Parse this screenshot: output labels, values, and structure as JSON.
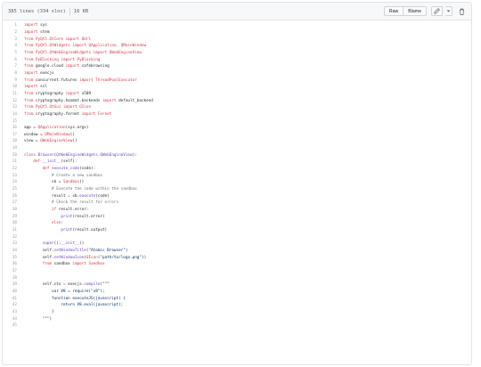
{
  "file_header": {
    "lines_info": "385 lines (334 sloc)",
    "size": "16 KB",
    "raw_label": "Raw",
    "blame_label": "Blame"
  },
  "icons": {
    "edit": "pencil-icon",
    "menu": "chevron-down-icon",
    "delete": "trash-icon"
  },
  "colors": {
    "keyword": "#d73a49",
    "class_name": "#6f42c1",
    "string": "#032f62",
    "comment": "#6a737d",
    "line_number": "#959da5"
  },
  "code_lines": [
    {
      "n": "1",
      "tokens": [
        {
          "t": "import",
          "c": "kw"
        },
        {
          "t": " sys",
          "c": ""
        }
      ]
    },
    {
      "n": "2",
      "tokens": [
        {
          "t": "import",
          "c": "kw"
        },
        {
          "t": " stem",
          "c": ""
        }
      ]
    },
    {
      "n": "3",
      "tokens": [
        {
          "t": "from",
          "c": "kw"
        },
        {
          "t": " ",
          "c": ""
        },
        {
          "t": "PyQt5.QtCore",
          "c": "kw"
        },
        {
          "t": " ",
          "c": ""
        },
        {
          "t": "import",
          "c": "kw"
        },
        {
          "t": " ",
          "c": ""
        },
        {
          "t": "QUrl",
          "c": "kw"
        }
      ]
    },
    {
      "n": "4",
      "tokens": [
        {
          "t": "from",
          "c": "kw"
        },
        {
          "t": " ",
          "c": ""
        },
        {
          "t": "PyQt5.QtWidgets",
          "c": "kw"
        },
        {
          "t": " ",
          "c": ""
        },
        {
          "t": "import",
          "c": "kw"
        },
        {
          "t": " ",
          "c": ""
        },
        {
          "t": "QApplication, QMainWindow",
          "c": "kw"
        }
      ]
    },
    {
      "n": "5",
      "tokens": [
        {
          "t": "from",
          "c": "kw"
        },
        {
          "t": " ",
          "c": ""
        },
        {
          "t": "PyQt5.QtWebEngineWidgets",
          "c": "kw"
        },
        {
          "t": " ",
          "c": ""
        },
        {
          "t": "import",
          "c": "kw"
        },
        {
          "t": " ",
          "c": ""
        },
        {
          "t": "QWebEngineView",
          "c": "kw"
        }
      ]
    },
    {
      "n": "6",
      "tokens": [
        {
          "t": "from",
          "c": "kw"
        },
        {
          "t": " ",
          "c": ""
        },
        {
          "t": "PyBlocking",
          "c": "kw"
        },
        {
          "t": " ",
          "c": ""
        },
        {
          "t": "import",
          "c": "kw"
        },
        {
          "t": " ",
          "c": ""
        },
        {
          "t": "PyBlocking",
          "c": "kw"
        }
      ]
    },
    {
      "n": "7",
      "tokens": [
        {
          "t": "from",
          "c": "kw"
        },
        {
          "t": " google.cloud ",
          "c": ""
        },
        {
          "t": "import",
          "c": "kw"
        },
        {
          "t": " safebrowsing",
          "c": ""
        }
      ]
    },
    {
      "n": "8",
      "tokens": [
        {
          "t": "import",
          "c": "kw"
        },
        {
          "t": " execjs",
          "c": ""
        }
      ]
    },
    {
      "n": "9",
      "tokens": [
        {
          "t": "from",
          "c": "kw"
        },
        {
          "t": " concurrent.futures ",
          "c": ""
        },
        {
          "t": "import",
          "c": "kw"
        },
        {
          "t": " ",
          "c": ""
        },
        {
          "t": "ThreadPoolExecutor",
          "c": "kw"
        }
      ]
    },
    {
      "n": "10",
      "tokens": [
        {
          "t": "import",
          "c": "kw"
        },
        {
          "t": " ssl",
          "c": ""
        }
      ]
    },
    {
      "n": "11",
      "tokens": [
        {
          "t": "from",
          "c": "kw"
        },
        {
          "t": " cryptography ",
          "c": ""
        },
        {
          "t": "import",
          "c": "kw"
        },
        {
          "t": " x509",
          "c": ""
        }
      ]
    },
    {
      "n": "12",
      "tokens": [
        {
          "t": "from",
          "c": "kw"
        },
        {
          "t": " cryptography.hazmat.backends ",
          "c": ""
        },
        {
          "t": "import",
          "c": "kw"
        },
        {
          "t": " default_backend",
          "c": ""
        }
      ]
    },
    {
      "n": "13",
      "tokens": [
        {
          "t": "from",
          "c": "kw"
        },
        {
          "t": " ",
          "c": ""
        },
        {
          "t": "PyQt5.QtGui",
          "c": "kw"
        },
        {
          "t": " ",
          "c": ""
        },
        {
          "t": "import",
          "c": "kw"
        },
        {
          "t": " ",
          "c": ""
        },
        {
          "t": "QIcon",
          "c": "kw"
        }
      ]
    },
    {
      "n": "14",
      "tokens": [
        {
          "t": "from",
          "c": "kw"
        },
        {
          "t": " cryptography.fernet ",
          "c": ""
        },
        {
          "t": "import",
          "c": "kw"
        },
        {
          "t": " ",
          "c": ""
        },
        {
          "t": "Fernet",
          "c": "kw"
        }
      ]
    },
    {
      "n": "15",
      "tokens": []
    },
    {
      "n": "16",
      "tokens": [
        {
          "t": "app = ",
          "c": ""
        },
        {
          "t": "QApplication",
          "c": "kw"
        },
        {
          "t": "(sys.argv)",
          "c": ""
        }
      ]
    },
    {
      "n": "17",
      "tokens": [
        {
          "t": "window = ",
          "c": ""
        },
        {
          "t": "QMainWindow",
          "c": "kw"
        },
        {
          "t": "()",
          "c": ""
        }
      ]
    },
    {
      "n": "18",
      "tokens": [
        {
          "t": "view = ",
          "c": ""
        },
        {
          "t": "QWebEngineView",
          "c": "kw"
        },
        {
          "t": "()",
          "c": ""
        }
      ]
    },
    {
      "n": "19",
      "tokens": []
    },
    {
      "n": "20",
      "tokens": [
        {
          "t": "class",
          "c": "kw"
        },
        {
          "t": " ",
          "c": ""
        },
        {
          "t": "Browser",
          "c": "cls"
        },
        {
          "t": "(",
          "c": ""
        },
        {
          "t": "QtWebEngineWidgets.QWebEngineView",
          "c": "cls"
        },
        {
          "t": "):",
          "c": ""
        }
      ]
    },
    {
      "n": "21",
      "tokens": [
        {
          "t": "    ",
          "c": ""
        },
        {
          "t": "def",
          "c": "kw"
        },
        {
          "t": " ",
          "c": ""
        },
        {
          "t": "__init__",
          "c": "fn"
        },
        {
          "t": "(self):",
          "c": ""
        }
      ]
    },
    {
      "n": "22",
      "tokens": [
        {
          "t": "        ",
          "c": ""
        },
        {
          "t": "def",
          "c": "kw"
        },
        {
          "t": " ",
          "c": ""
        },
        {
          "t": "execute_code",
          "c": "fn"
        },
        {
          "t": "(code):",
          "c": ""
        }
      ]
    },
    {
      "n": "23",
      "tokens": [
        {
          "t": "            ",
          "c": ""
        },
        {
          "t": "# Create a new sandbox",
          "c": "cm"
        }
      ]
    },
    {
      "n": "24",
      "tokens": [
        {
          "t": "            sb = ",
          "c": ""
        },
        {
          "t": "Sandbox",
          "c": "kw"
        },
        {
          "t": "()",
          "c": ""
        }
      ]
    },
    {
      "n": "25",
      "tokens": [
        {
          "t": "            ",
          "c": ""
        },
        {
          "t": "# Execute the code within the sandbox",
          "c": "cm"
        }
      ]
    },
    {
      "n": "26",
      "tokens": [
        {
          "t": "            result ",
          "c": ""
        },
        {
          "t": "=",
          "c": "kw"
        },
        {
          "t": " sb.",
          "c": ""
        },
        {
          "t": "execute",
          "c": "fn"
        },
        {
          "t": "(code)",
          "c": ""
        }
      ]
    },
    {
      "n": "27",
      "tokens": [
        {
          "t": "            ",
          "c": ""
        },
        {
          "t": "# Check the result for errors",
          "c": "cm"
        }
      ]
    },
    {
      "n": "28",
      "tokens": [
        {
          "t": "            ",
          "c": ""
        },
        {
          "t": "if",
          "c": "kw"
        },
        {
          "t": " result.error:",
          "c": ""
        }
      ]
    },
    {
      "n": "29",
      "tokens": [
        {
          "t": "                ",
          "c": ""
        },
        {
          "t": "print",
          "c": "fn"
        },
        {
          "t": "(result.error)",
          "c": ""
        }
      ]
    },
    {
      "n": "30",
      "tokens": [
        {
          "t": "            ",
          "c": ""
        },
        {
          "t": "else",
          "c": "kw"
        },
        {
          "t": ":",
          "c": ""
        }
      ]
    },
    {
      "n": "31",
      "tokens": [
        {
          "t": "                ",
          "c": ""
        },
        {
          "t": "print",
          "c": "fn"
        },
        {
          "t": "(result.output)",
          "c": ""
        }
      ]
    },
    {
      "n": "32",
      "tokens": []
    },
    {
      "n": "33",
      "tokens": [
        {
          "t": "        ",
          "c": ""
        },
        {
          "t": "super",
          "c": "fn"
        },
        {
          "t": "().",
          "c": ""
        },
        {
          "t": "__init__",
          "c": "fn"
        },
        {
          "t": "()",
          "c": ""
        }
      ]
    },
    {
      "n": "34",
      "tokens": [
        {
          "t": "        self.",
          "c": ""
        },
        {
          "t": "setWindowTitle",
          "c": "fn"
        },
        {
          "t": "(",
          "c": ""
        },
        {
          "t": "\"Atomic Browser\"",
          "c": "str"
        },
        {
          "t": ")",
          "c": ""
        }
      ]
    },
    {
      "n": "35",
      "tokens": [
        {
          "t": "        self.",
          "c": ""
        },
        {
          "t": "setWindowIcon",
          "c": "fn"
        },
        {
          "t": "(",
          "c": ""
        },
        {
          "t": "QIcon",
          "c": "kw"
        },
        {
          "t": "(",
          "c": ""
        },
        {
          "t": "\"path/to/logo.png\"",
          "c": "str"
        },
        {
          "t": "))",
          "c": ""
        }
      ]
    },
    {
      "n": "36",
      "tokens": [
        {
          "t": "        ",
          "c": ""
        },
        {
          "t": "from",
          "c": "kw"
        },
        {
          "t": " sandbox ",
          "c": ""
        },
        {
          "t": "import",
          "c": "kw"
        },
        {
          "t": " ",
          "c": ""
        },
        {
          "t": "Sandbox",
          "c": "kw"
        }
      ]
    },
    {
      "n": "37",
      "tokens": []
    },
    {
      "n": "38",
      "tokens": []
    },
    {
      "n": "39",
      "tokens": [
        {
          "t": "        self.ctx ",
          "c": ""
        },
        {
          "t": "=",
          "c": "kw"
        },
        {
          "t": " execjs.",
          "c": ""
        },
        {
          "t": "compile",
          "c": "fn"
        },
        {
          "t": "(",
          "c": ""
        },
        {
          "t": "\"\"\"",
          "c": "str"
        }
      ]
    },
    {
      "n": "40",
      "tokens": [
        {
          "t": "            var V8 = require(\"v8\");",
          "c": "str"
        }
      ]
    },
    {
      "n": "41",
      "tokens": [
        {
          "t": "            function executeJS(javascript) {",
          "c": "str"
        }
      ]
    },
    {
      "n": "42",
      "tokens": [
        {
          "t": "                return V8.eval(javascript);",
          "c": "str"
        }
      ]
    },
    {
      "n": "43",
      "tokens": [
        {
          "t": "            }",
          "c": "str"
        }
      ]
    },
    {
      "n": "44",
      "tokens": [
        {
          "t": "        \"\"\"",
          "c": "str"
        },
        {
          "t": ")",
          "c": ""
        }
      ]
    },
    {
      "n": "45",
      "tokens": []
    }
  ]
}
